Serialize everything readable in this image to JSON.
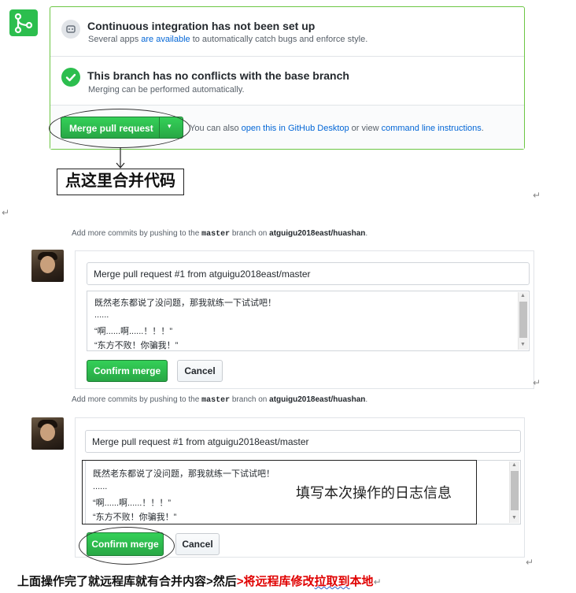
{
  "merge_panel": {
    "ci_title": "Continuous integration has not been set up",
    "ci_desc_prefix": "Several apps ",
    "ci_desc_link": "are available",
    "ci_desc_suffix": " to automatically catch bugs and enforce style.",
    "conflict_title": "This branch has no conflicts with the base branch",
    "conflict_desc": "Merging can be performed automatically.",
    "merge_button": "Merge pull request",
    "dropdown_caret": "▾",
    "also_prefix": "You can also ",
    "desktop_link": "open this in GitHub Desktop",
    "also_middle": " or view ",
    "cli_link": "command line instructions",
    "also_suffix": "."
  },
  "callout": "点这里合并代码",
  "para_mark": "↵",
  "para_mark_left": "↵",
  "confirm_1": {
    "note_prefix": "Add more commits by pushing to the ",
    "branch": "master",
    "note_middle": " branch on ",
    "repo": "atguigu2018east/huashan",
    "note_suffix": ".",
    "title_value": "Merge pull request #1 from atguigu2018east/master",
    "body_lines": [
      "既然老东都说了没问题，那我就练一下试试吧！",
      "......",
      "“啊......啊......！！！”",
      "“东方不败！你骗我！”"
    ],
    "confirm_label": "Confirm merge",
    "cancel_label": "Cancel"
  },
  "confirm_2": {
    "note_prefix": "Add more commits by pushing to the ",
    "branch": "master",
    "note_middle": " branch on ",
    "repo": "atguigu2018east/huashan",
    "note_suffix": ".",
    "title_value": "Merge pull request #1 from atguigu2018east/master",
    "body_lines": [
      "既然老东都说了没问题，那我就练一下试试吧！",
      "......",
      "“啊......啊......！！！”",
      "“东方不败！你骗我！”"
    ],
    "annotation": "填写本次操作的日志信息",
    "confirm_label": "Confirm merge",
    "cancel_label": "Cancel"
  },
  "footer": {
    "black": "上面操作完了就远程库就有合并内容>然后",
    "red_prefix": ">将远程库修改",
    "red_squiggle": "拉取到",
    "red_suffix": "本地"
  },
  "colors": {
    "accent_green": "#2cbe4e",
    "link_blue": "#0366d6",
    "footer_red": "#e00000"
  }
}
